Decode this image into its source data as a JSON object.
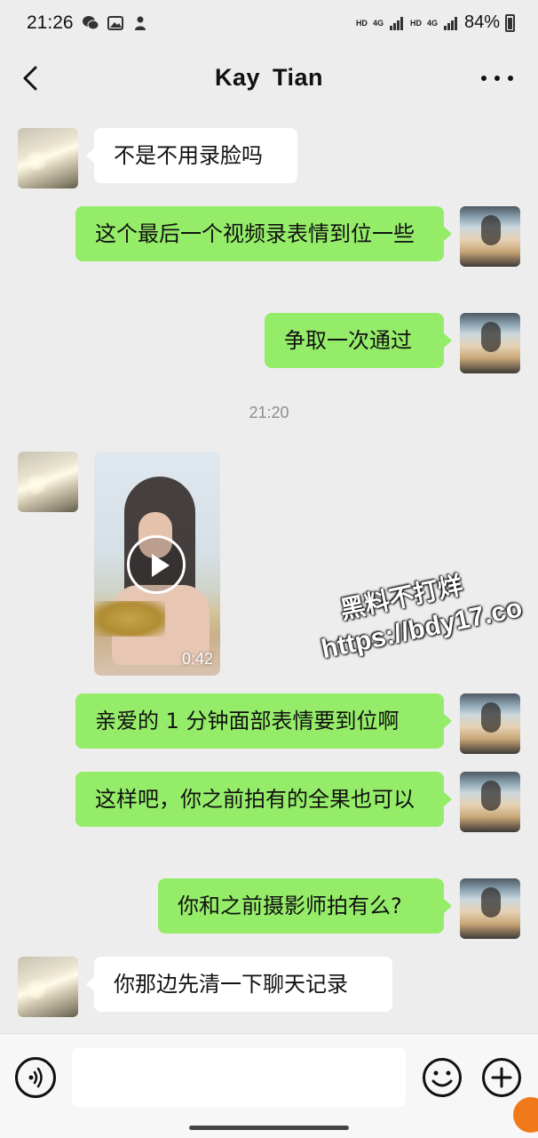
{
  "status_bar": {
    "time": "21:26",
    "net1": "4G",
    "net2": "4G",
    "hd1": "HD",
    "hd2": "HD",
    "battery": "84%"
  },
  "header": {
    "title": "Kay  Tian"
  },
  "messages": [
    {
      "side": "in",
      "text": "不是不用录脸吗"
    },
    {
      "side": "out",
      "text": "这个最后一个视频录表情到位一些"
    },
    {
      "side": "out",
      "text": "争取一次通过"
    },
    {
      "type": "timestamp",
      "text": "21:20"
    },
    {
      "side": "in",
      "type": "video",
      "duration": "0:42"
    },
    {
      "side": "out",
      "text": "亲爱的 1 分钟面部表情要到位啊"
    },
    {
      "side": "out",
      "text": "这样吧，你之前拍有的全果也可以"
    },
    {
      "side": "out",
      "text": "你和之前摄影师拍有么?"
    },
    {
      "side": "in",
      "text": "你那边先清一下聊天记录"
    }
  ],
  "watermark": {
    "line1": "黑料不打烊",
    "line2": "https://bdy17.co"
  },
  "input": {
    "value": ""
  },
  "colors": {
    "outgoing_bubble": "#95ec69",
    "incoming_bubble": "#ffffff",
    "background": "#ededed"
  },
  "icons": {
    "back": "chevron-left-icon",
    "more": "more-dots-icon",
    "voice": "voice-icon",
    "emoji": "emoji-icon",
    "plus": "plus-icon"
  }
}
